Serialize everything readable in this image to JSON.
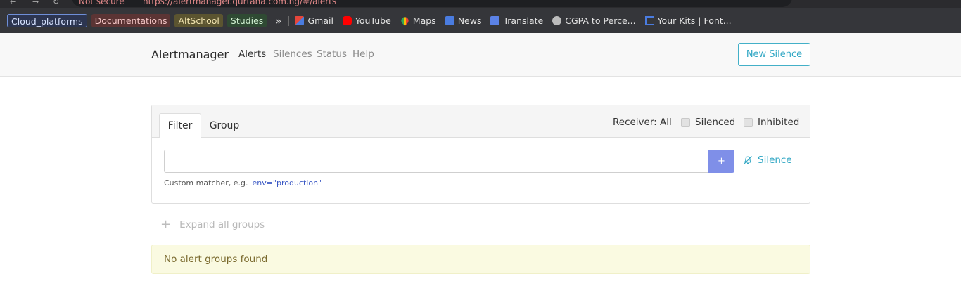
{
  "browser": {
    "url_warning": "Not secure",
    "url": "https://alertmanager.qurtana.com.ng/#/alerts",
    "bookmarks": {
      "folders": [
        {
          "label": "Cloud_platforms"
        },
        {
          "label": "Documentations"
        },
        {
          "label": "AltSchool"
        },
        {
          "label": "Studies"
        }
      ],
      "more": "»",
      "links": [
        {
          "label": "Gmail",
          "icon": "gmail-icon",
          "color": "#e5463b"
        },
        {
          "label": "YouTube",
          "icon": "youtube-icon",
          "color": "#ff0000"
        },
        {
          "label": "Maps",
          "icon": "maps-icon",
          "color": "#34a853"
        },
        {
          "label": "News",
          "icon": "news-icon",
          "color": "#4a7ce0"
        },
        {
          "label": "Translate",
          "icon": "translate-icon",
          "color": "#5b82e6"
        },
        {
          "label": "CGPA to Perce...",
          "icon": "globe-icon",
          "color": "#bcbcbc"
        },
        {
          "label": "Your Kits | Font...",
          "icon": "flag-icon",
          "color": "#4a7ce0"
        }
      ]
    }
  },
  "navbar": {
    "brand": "Alertmanager",
    "links": [
      "Alerts",
      "Silences",
      "Status",
      "Help"
    ],
    "active": "Alerts",
    "new_silence": "New Silence"
  },
  "filter_card": {
    "tabs": [
      "Filter",
      "Group"
    ],
    "active_tab": "Filter",
    "receiver": "Receiver: All",
    "checkboxes": [
      "Silenced",
      "Inhibited"
    ],
    "input_value": "",
    "add_button": "+",
    "silence_link": "Silence",
    "hint_label": "Custom matcher, e.g.",
    "hint_example": "env=\"production\""
  },
  "expand_groups": {
    "label": "Expand all groups"
  },
  "alerts": {
    "empty_message": "No alert groups found"
  },
  "colors": {
    "accent": "#31a7c4",
    "add_button": "#7f8fe8",
    "empty_bg": "#fafae1"
  }
}
